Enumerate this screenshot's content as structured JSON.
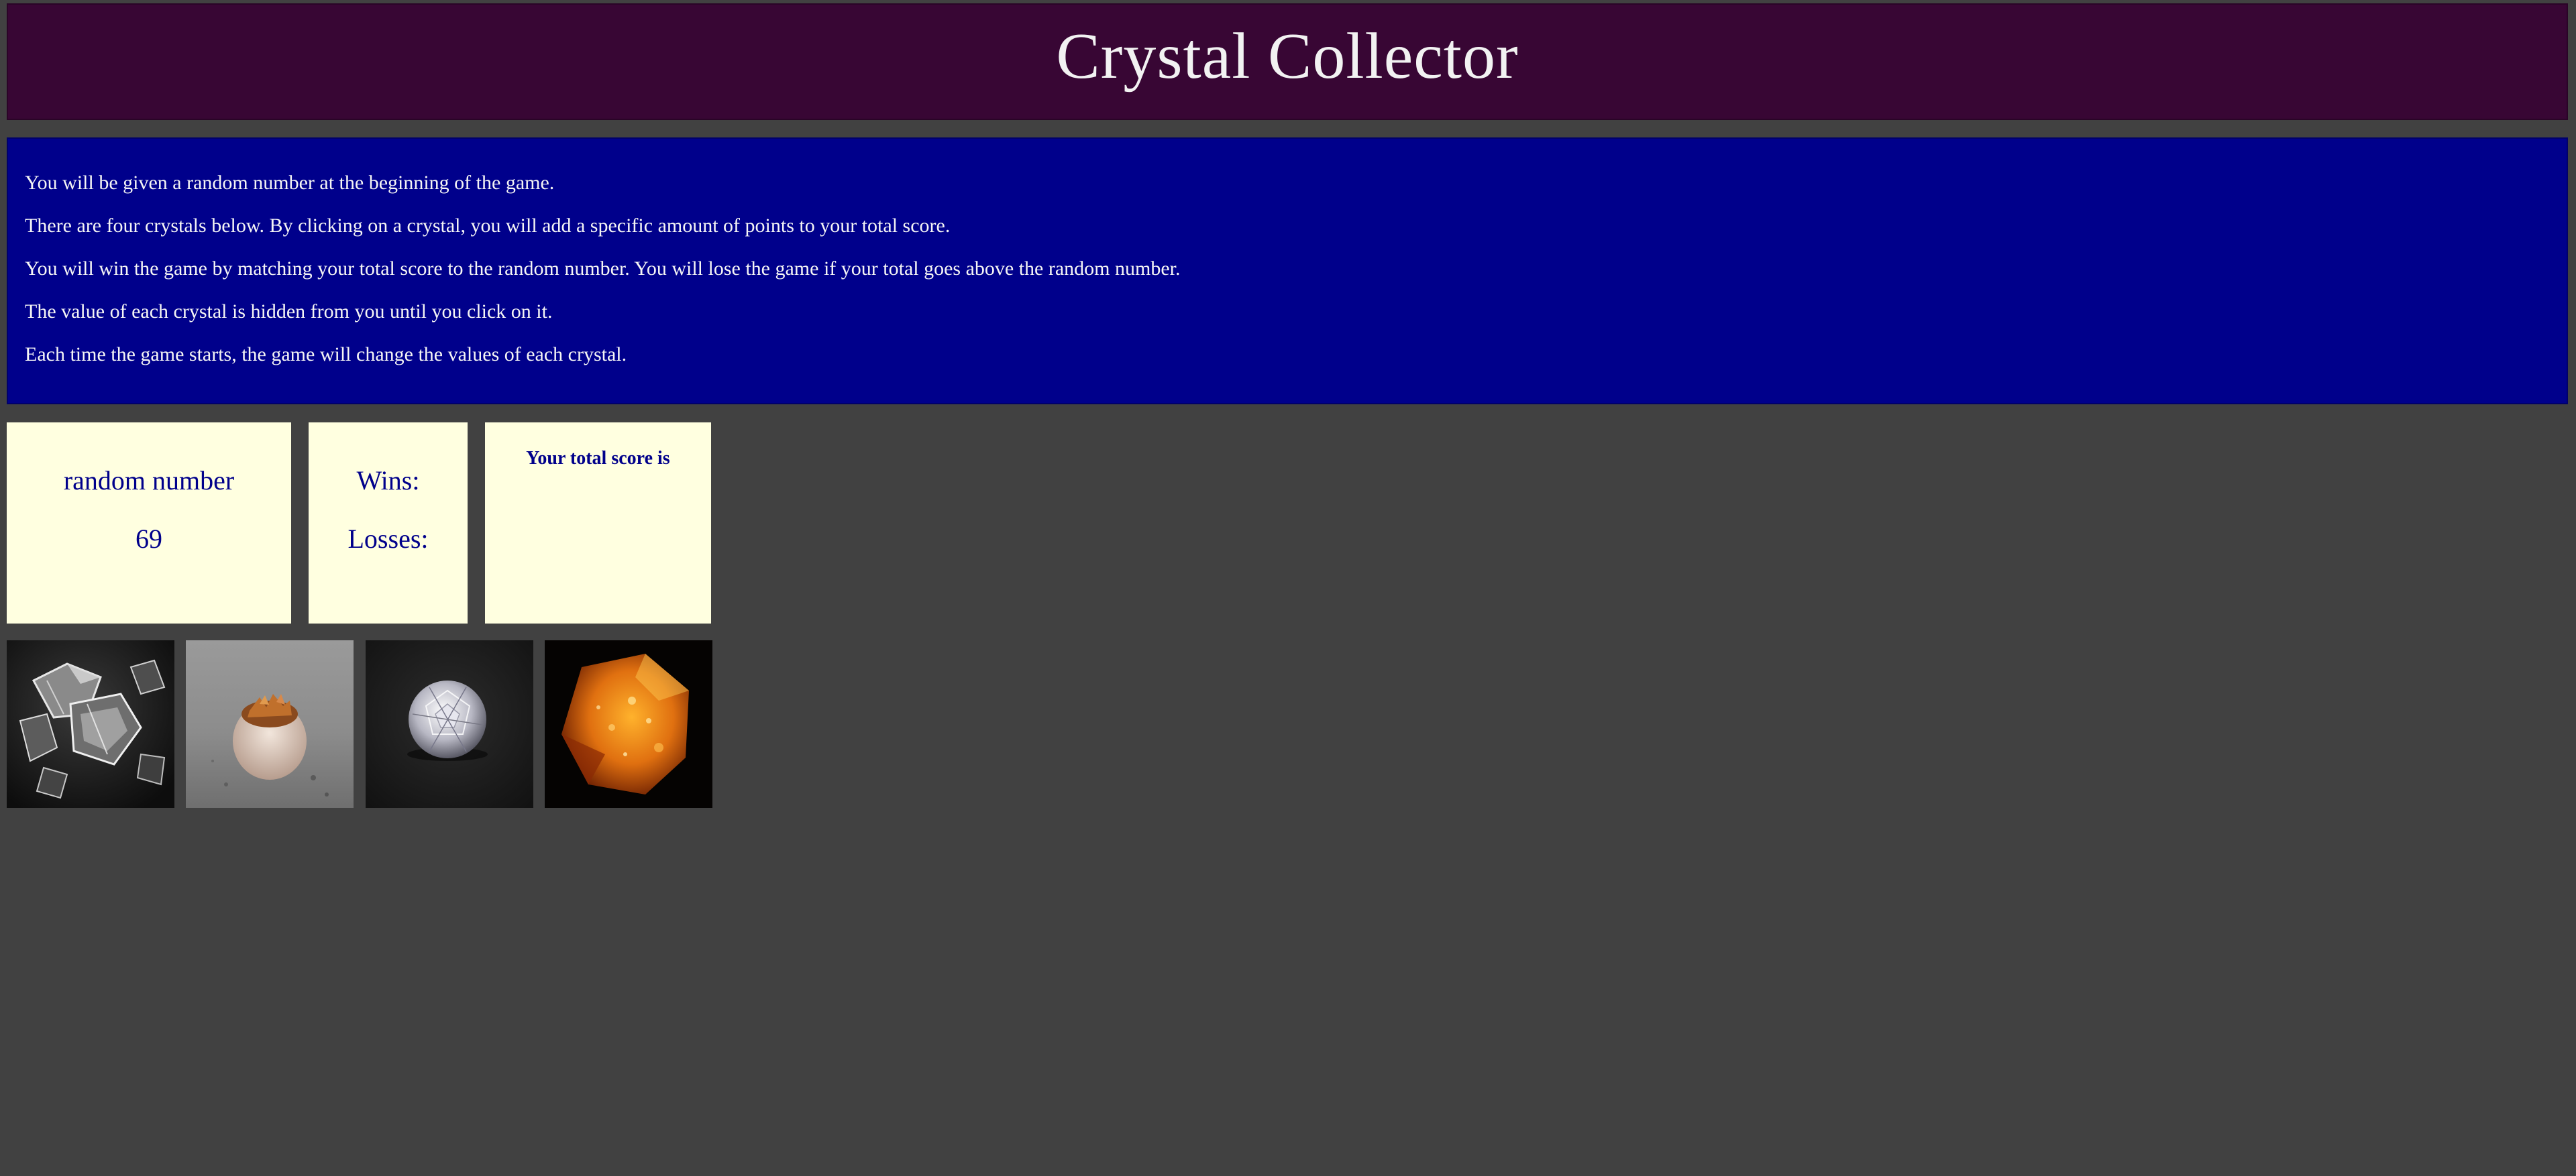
{
  "header": {
    "title": "Crystal Collector"
  },
  "instructions": [
    "You will be given a random number at the beginning of the game.",
    "There are four crystals below. By clicking on a crystal, you will add a specific amount of points to your total score.",
    "You will win the game by matching your total score to the random number. You will lose the game if your total goes above the random number.",
    "The value of each crystal is hidden from you until you click on it.",
    "Each time the game starts, the game will change the values of each crystal."
  ],
  "random_panel": {
    "label": "random number",
    "value": "69"
  },
  "record_panel": {
    "wins_label": "Wins:",
    "losses_label": "Losses:"
  },
  "score_panel": {
    "label": "Your total score is"
  },
  "crystals": [
    {
      "name": "clear-quartz-cluster-crystal"
    },
    {
      "name": "citrine-geode-crystal"
    },
    {
      "name": "cut-diamond-crystal"
    },
    {
      "name": "amber-crystal"
    }
  ],
  "colors": {
    "background": "#414141",
    "title_bar": "#380634",
    "instructions_bg": "#00008b",
    "panel_bg": "#ffffe0",
    "panel_text": "#00008b"
  }
}
